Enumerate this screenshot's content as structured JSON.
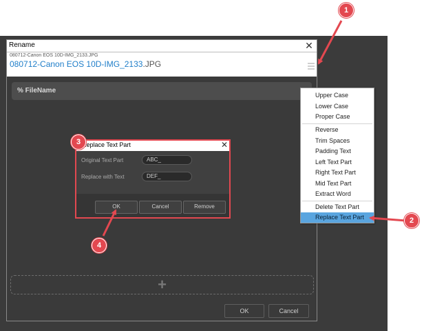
{
  "rename_window": {
    "title": "Rename",
    "preview_small": "080712-Canon EOS 10D-IMG_2133.JPG",
    "preview_main_name": "080712-Canon EOS 10D-IMG_2133",
    "preview_main_ext": ".JPG",
    "filename_token": "% FileName",
    "add_label": "+",
    "ok_label": "OK",
    "cancel_label": "Cancel"
  },
  "menu": {
    "items": [
      "Upper Case",
      "Lower Case",
      "Proper Case",
      "Reverse",
      "Trim Spaces",
      "Padding Text",
      "Left Text Part",
      "Right Text Part",
      "Mid Text Part",
      "Extract Word",
      "Delete Text Part",
      "Replace Text Part"
    ],
    "selected": "Replace Text Part"
  },
  "dialog": {
    "title": "Replace Text Part",
    "original_label": "Original Text Part",
    "original_value": "ABC_",
    "replace_label": "Replace with Text",
    "replace_value": "DEF_",
    "ok_label": "OK",
    "cancel_label": "Cancel",
    "remove_label": "Remove"
  },
  "callouts": {
    "c1": "1",
    "c2": "2",
    "c3": "3",
    "c4": "4"
  },
  "colors": {
    "accent_red": "#e34850",
    "selection_blue": "#5aa5df",
    "filename_blue": "#1f7ec9",
    "dark_bg": "#3a3a3a"
  }
}
